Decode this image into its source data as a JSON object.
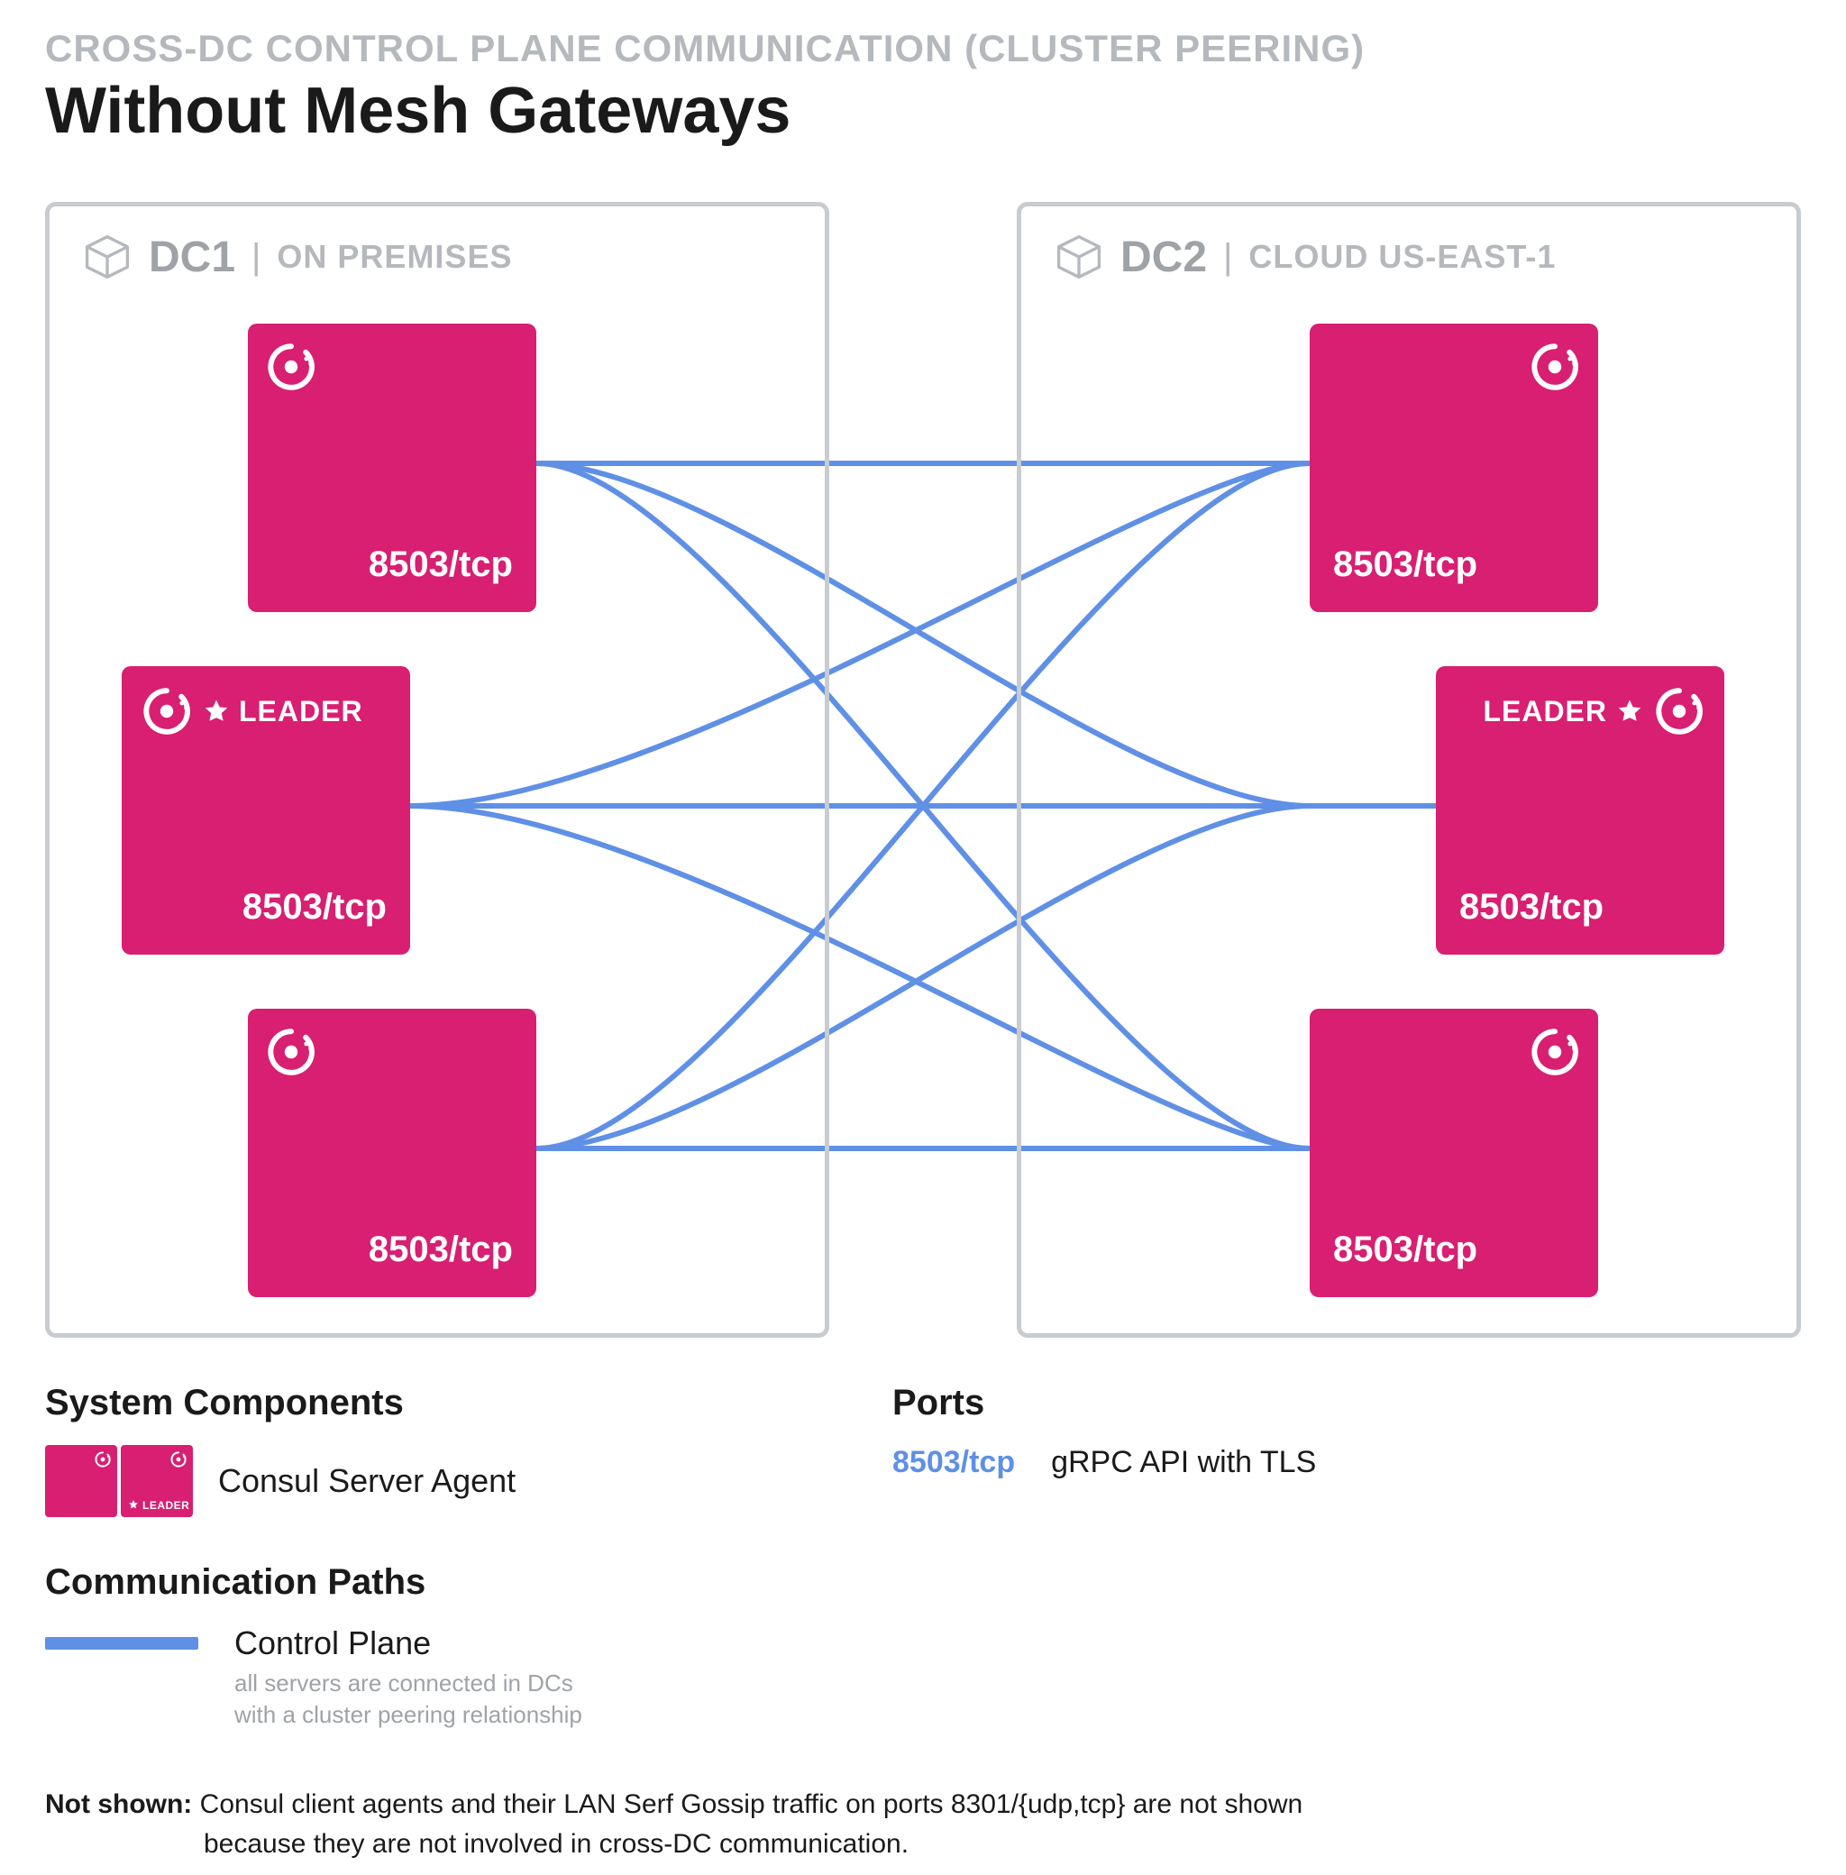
{
  "eyebrow": "CROSS-DC CONTROL PLANE COMMUNICATION (CLUSTER PEERING)",
  "title": "Without Mesh Gateways",
  "dc1": {
    "name": "DC1",
    "location": "ON PREMISES",
    "nodes": [
      {
        "port": "8503/tcp",
        "leader": false
      },
      {
        "port": "8503/tcp",
        "leader": true,
        "leader_label": "LEADER"
      },
      {
        "port": "8503/tcp",
        "leader": false
      }
    ]
  },
  "dc2": {
    "name": "DC2",
    "location": "CLOUD US-EAST-1",
    "nodes": [
      {
        "port": "8503/tcp",
        "leader": false
      },
      {
        "port": "8503/tcp",
        "leader": true,
        "leader_label": "LEADER"
      },
      {
        "port": "8503/tcp",
        "leader": false
      }
    ]
  },
  "legend": {
    "components_heading": "System Components",
    "consul_server_label": "Consul Server Agent",
    "mini_leader_label": "LEADER",
    "ports_heading": "Ports",
    "ports_key": "8503/tcp",
    "ports_desc": "gRPC API with TLS",
    "comm_heading": "Communication Paths",
    "comm_label": "Control Plane",
    "comm_sub_line1": "all servers are connected in DCs",
    "comm_sub_line2": "with a cluster peering relationship"
  },
  "footnote": {
    "prefix": "Not shown:",
    "body_line1": "Consul client agents and their LAN Serf Gossip traffic on ports 8301/{udp,tcp} are not shown",
    "body_line2": "because they are not involved in cross-DC communication."
  }
}
